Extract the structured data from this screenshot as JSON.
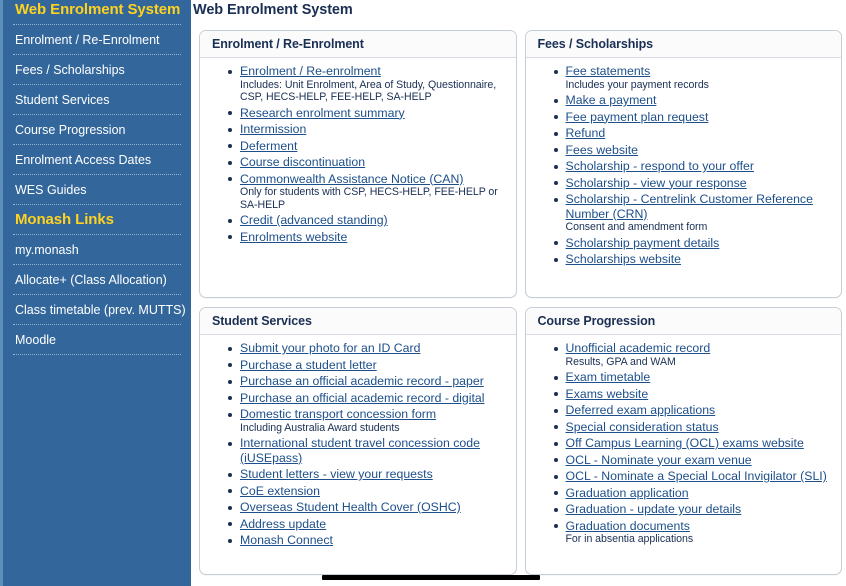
{
  "header": {
    "title": "Web Enrolment System"
  },
  "sidebar": {
    "sections": [
      {
        "heading": "Web Enrolment System",
        "items": [
          "Enrolment / Re-Enrolment",
          "Fees / Scholarships",
          "Student Services",
          "Course Progression",
          "Enrolment Access Dates",
          "WES Guides"
        ]
      },
      {
        "heading": "Monash Links",
        "items": [
          "my.monash",
          "Allocate+ (Class Allocation)",
          "Class timetable (prev. MUTTS)",
          "Moodle"
        ]
      }
    ]
  },
  "panels": [
    {
      "title": "Enrolment / Re-Enrolment",
      "items": [
        {
          "label": "Enrolment / Re-enrolment",
          "note": "Includes: Unit Enrolment, Area of Study, Questionnaire, CSP, HECS-HELP, FEE-HELP, SA-HELP"
        },
        {
          "label": "Research enrolment summary",
          "note": ""
        },
        {
          "label": "Intermission",
          "note": ""
        },
        {
          "label": "Deferment",
          "note": ""
        },
        {
          "label": "Course discontinuation",
          "note": ""
        },
        {
          "label": "Commonwealth Assistance Notice (CAN)",
          "note": "Only for students with CSP, HECS-HELP, FEE-HELP or SA-HELP"
        },
        {
          "label": "Credit (advanced standing)",
          "note": ""
        },
        {
          "label": "Enrolments website",
          "note": ""
        }
      ]
    },
    {
      "title": "Fees / Scholarships",
      "items": [
        {
          "label": "Fee statements",
          "note": "Includes your payment records"
        },
        {
          "label": "Make a payment",
          "note": ""
        },
        {
          "label": "Fee payment plan request",
          "note": ""
        },
        {
          "label": "Refund",
          "note": ""
        },
        {
          "label": "Fees website",
          "note": ""
        },
        {
          "label": "Scholarship - respond to your offer",
          "note": ""
        },
        {
          "label": "Scholarship - view your response",
          "note": ""
        },
        {
          "label": "Scholarship - Centrelink Customer Reference Number (CRN)",
          "note": "Consent and amendment form"
        },
        {
          "label": "Scholarship payment details",
          "note": ""
        },
        {
          "label": "Scholarships website",
          "note": ""
        }
      ]
    },
    {
      "title": "Student Services",
      "items": [
        {
          "label": "Submit your photo for an ID Card",
          "note": ""
        },
        {
          "label": "Purchase a student letter",
          "note": ""
        },
        {
          "label": "Purchase an official academic record - paper",
          "note": ""
        },
        {
          "label": "Purchase an official academic record - digital",
          "note": ""
        },
        {
          "label": "Domestic transport concession form",
          "note": "Including Australia Award students"
        },
        {
          "label": "International student travel concession code (iUSEpass)",
          "note": ""
        },
        {
          "label": "Student letters - view your requests",
          "note": ""
        },
        {
          "label": "CoE extension",
          "note": ""
        },
        {
          "label": "Overseas Student Health Cover (OSHC)",
          "note": ""
        },
        {
          "label": "Address update",
          "note": ""
        },
        {
          "label": "Monash Connect",
          "note": ""
        }
      ]
    },
    {
      "title": "Course Progression",
      "items": [
        {
          "label": "Unofficial academic record",
          "note": "Results, GPA and WAM"
        },
        {
          "label": "Exam timetable",
          "note": ""
        },
        {
          "label": "Exams website",
          "note": ""
        },
        {
          "label": "Deferred exam applications",
          "note": ""
        },
        {
          "label": "Special consideration status",
          "note": ""
        },
        {
          "label": "Off Campus Learning (OCL) exams website",
          "note": ""
        },
        {
          "label": "OCL - Nominate your exam venue",
          "note": ""
        },
        {
          "label": "OCL - Nominate a Special Local Invigilator (SLI)",
          "note": ""
        },
        {
          "label": "Graduation application",
          "note": ""
        },
        {
          "label": "Graduation - update your details",
          "note": ""
        },
        {
          "label": "Graduation documents",
          "note": "For in absentia applications"
        }
      ]
    }
  ],
  "colors": {
    "sidebar_bg": "#33679c",
    "sidebar_heading": "#ffd21f",
    "link": "#1d4f8a",
    "title": "#1a2f54"
  }
}
